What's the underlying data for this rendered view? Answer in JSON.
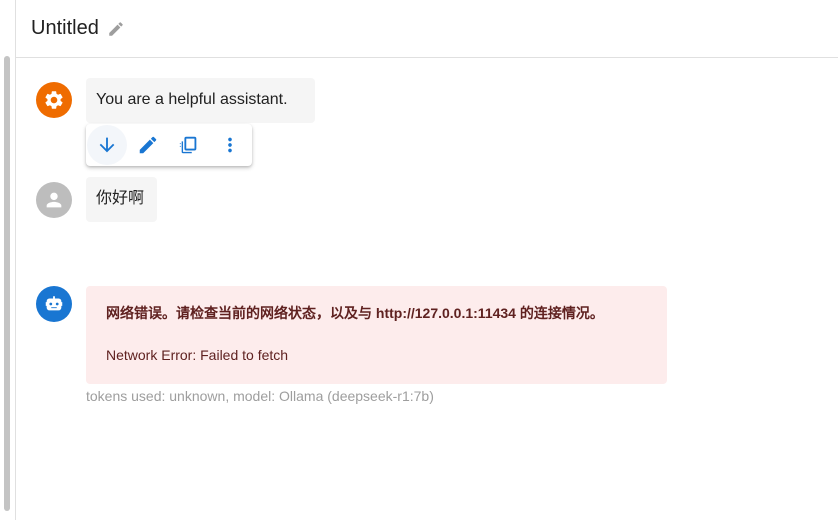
{
  "header": {
    "title": "Untitled",
    "edit_icon": "pencil-icon"
  },
  "messages": {
    "system": {
      "avatar_icon": "gear-icon",
      "avatar_color": "#ef6c00",
      "text": "You are a helpful assistant."
    },
    "toolbar": {
      "items": [
        {
          "icon": "arrow-down-icon"
        },
        {
          "icon": "pencil-icon"
        },
        {
          "icon": "copy-icon"
        },
        {
          "icon": "more-vert-icon"
        }
      ],
      "icon_color": "#1976d2"
    },
    "user": {
      "avatar_icon": "person-icon",
      "avatar_color": "#bdbdbd",
      "text": "你好啊"
    },
    "assistant": {
      "avatar_icon": "robot-icon",
      "avatar_color": "#1976d2",
      "error_title": "网络错误。请检查当前的网络状态，以及与 http://127.0.0.1:11434 的连接情况。",
      "error_detail": "Network Error: Failed to fetch",
      "meta": "tokens used: unknown, model: Ollama (deepseek-r1:7b)"
    }
  }
}
